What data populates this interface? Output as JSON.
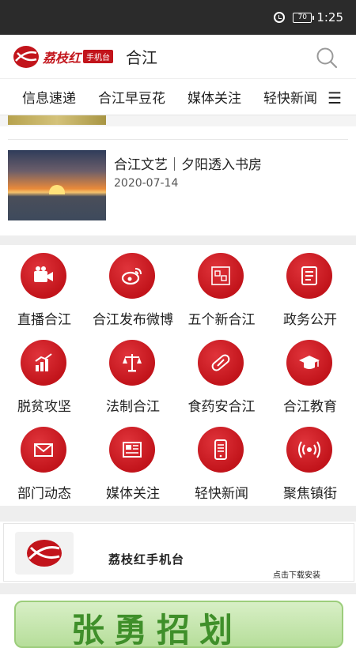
{
  "status_bar": {
    "battery": "70",
    "time": "1:25"
  },
  "header": {
    "logo_text": "荔枝红",
    "logo_badge": "手机台",
    "title": "合江"
  },
  "nav": {
    "tabs": [
      "信息速递",
      "合江早豆花",
      "媒体关注",
      "轻快新闻"
    ]
  },
  "article": {
    "title": "合江文艺｜夕阳透入书房",
    "date": "2020-07-14"
  },
  "grid": {
    "items": [
      {
        "label": "直播合江",
        "icon": "video-camera-icon"
      },
      {
        "label": "合江发布微博",
        "icon": "weibo-icon"
      },
      {
        "label": "五个新合江",
        "icon": "five-new-hejiang-icon"
      },
      {
        "label": "政务公开",
        "icon": "document-icon"
      },
      {
        "label": "脱贫攻坚",
        "icon": "bar-chart-icon"
      },
      {
        "label": "法制合江",
        "icon": "scales-icon"
      },
      {
        "label": "食药安合江",
        "icon": "pill-icon"
      },
      {
        "label": "合江教育",
        "icon": "graduation-cap-icon"
      },
      {
        "label": "部门动态",
        "icon": "mail-icon"
      },
      {
        "label": "媒体关注",
        "icon": "newspaper-icon"
      },
      {
        "label": "轻快新闻",
        "icon": "phone-news-icon"
      },
      {
        "label": "聚焦镇街",
        "icon": "broadcast-icon"
      }
    ]
  },
  "banner": {
    "title": "荔枝红手机台",
    "subtitle": "点击下载安装"
  },
  "bottom_banner": {
    "text": "张勇招划"
  },
  "colors": {
    "brand_red": "#c2141b",
    "bottom_green": "#3f8f2a"
  }
}
